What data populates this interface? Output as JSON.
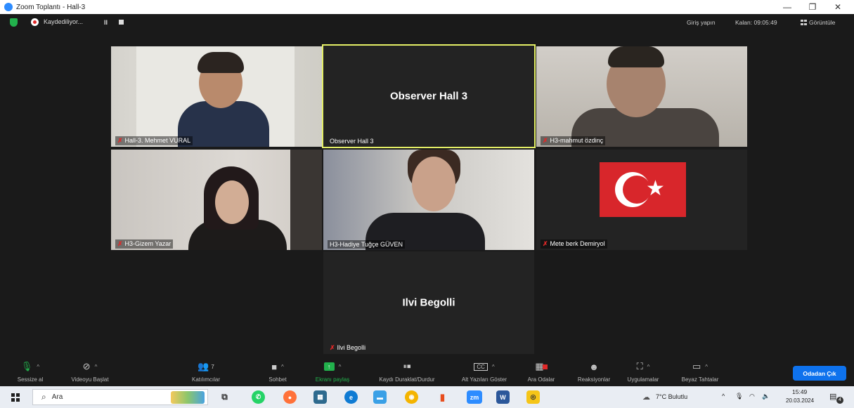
{
  "window": {
    "title": "Zoom Toplantı - Hall-3"
  },
  "topbar": {
    "recording_label": "Kaydediliyor...",
    "pause_symbol": "II",
    "signin": "Giriş yapın",
    "remaining": "Kalan: 09:05:49",
    "view": "Görüntüle"
  },
  "tiles": {
    "t1": {
      "name": "Hall-3. Mehmet VURAL"
    },
    "t2": {
      "name": "Observer Hall 3",
      "big": "Observer Hall 3"
    },
    "t3": {
      "name": "H3-mahmut özdinç"
    },
    "t4": {
      "name": "H3-Gizem Yazar"
    },
    "t5": {
      "name": "H3-Hadiye Tuğçe GÜVEN"
    },
    "t6": {
      "name": "Mete berk Demiryol"
    },
    "t7": {
      "name": "Ilvi Begolli",
      "big": "Ilvi Begolli"
    }
  },
  "toolbar": {
    "mute": "Sessize al",
    "video": "Videoyu Başlat",
    "participants": "Katılımcılar",
    "participants_count": "7",
    "chat": "Sohbet",
    "share": "Ekranı paylaş",
    "record": "Kaydı Duraklat/Durdur",
    "captions": "Alt Yazıları Göster",
    "captions_icon": "CC",
    "breakout": "Ara Odalar",
    "reactions": "Reaksiyonlar",
    "apps": "Uygulamalar",
    "whiteboard": "Beyaz Tahtalar",
    "leave": "Odadan Çık"
  },
  "taskbar": {
    "search_placeholder": "Ara",
    "weather": "7°C Bulutlu",
    "time": "15:49",
    "date": "20.03.2024",
    "notifications": "4",
    "zoom_label": "zm",
    "word_label": "W"
  },
  "colors": {
    "accent": "#0e72ed",
    "active_speaker": "#e4ef66",
    "mic_off": "#e02828",
    "share_green": "#22b14c"
  }
}
